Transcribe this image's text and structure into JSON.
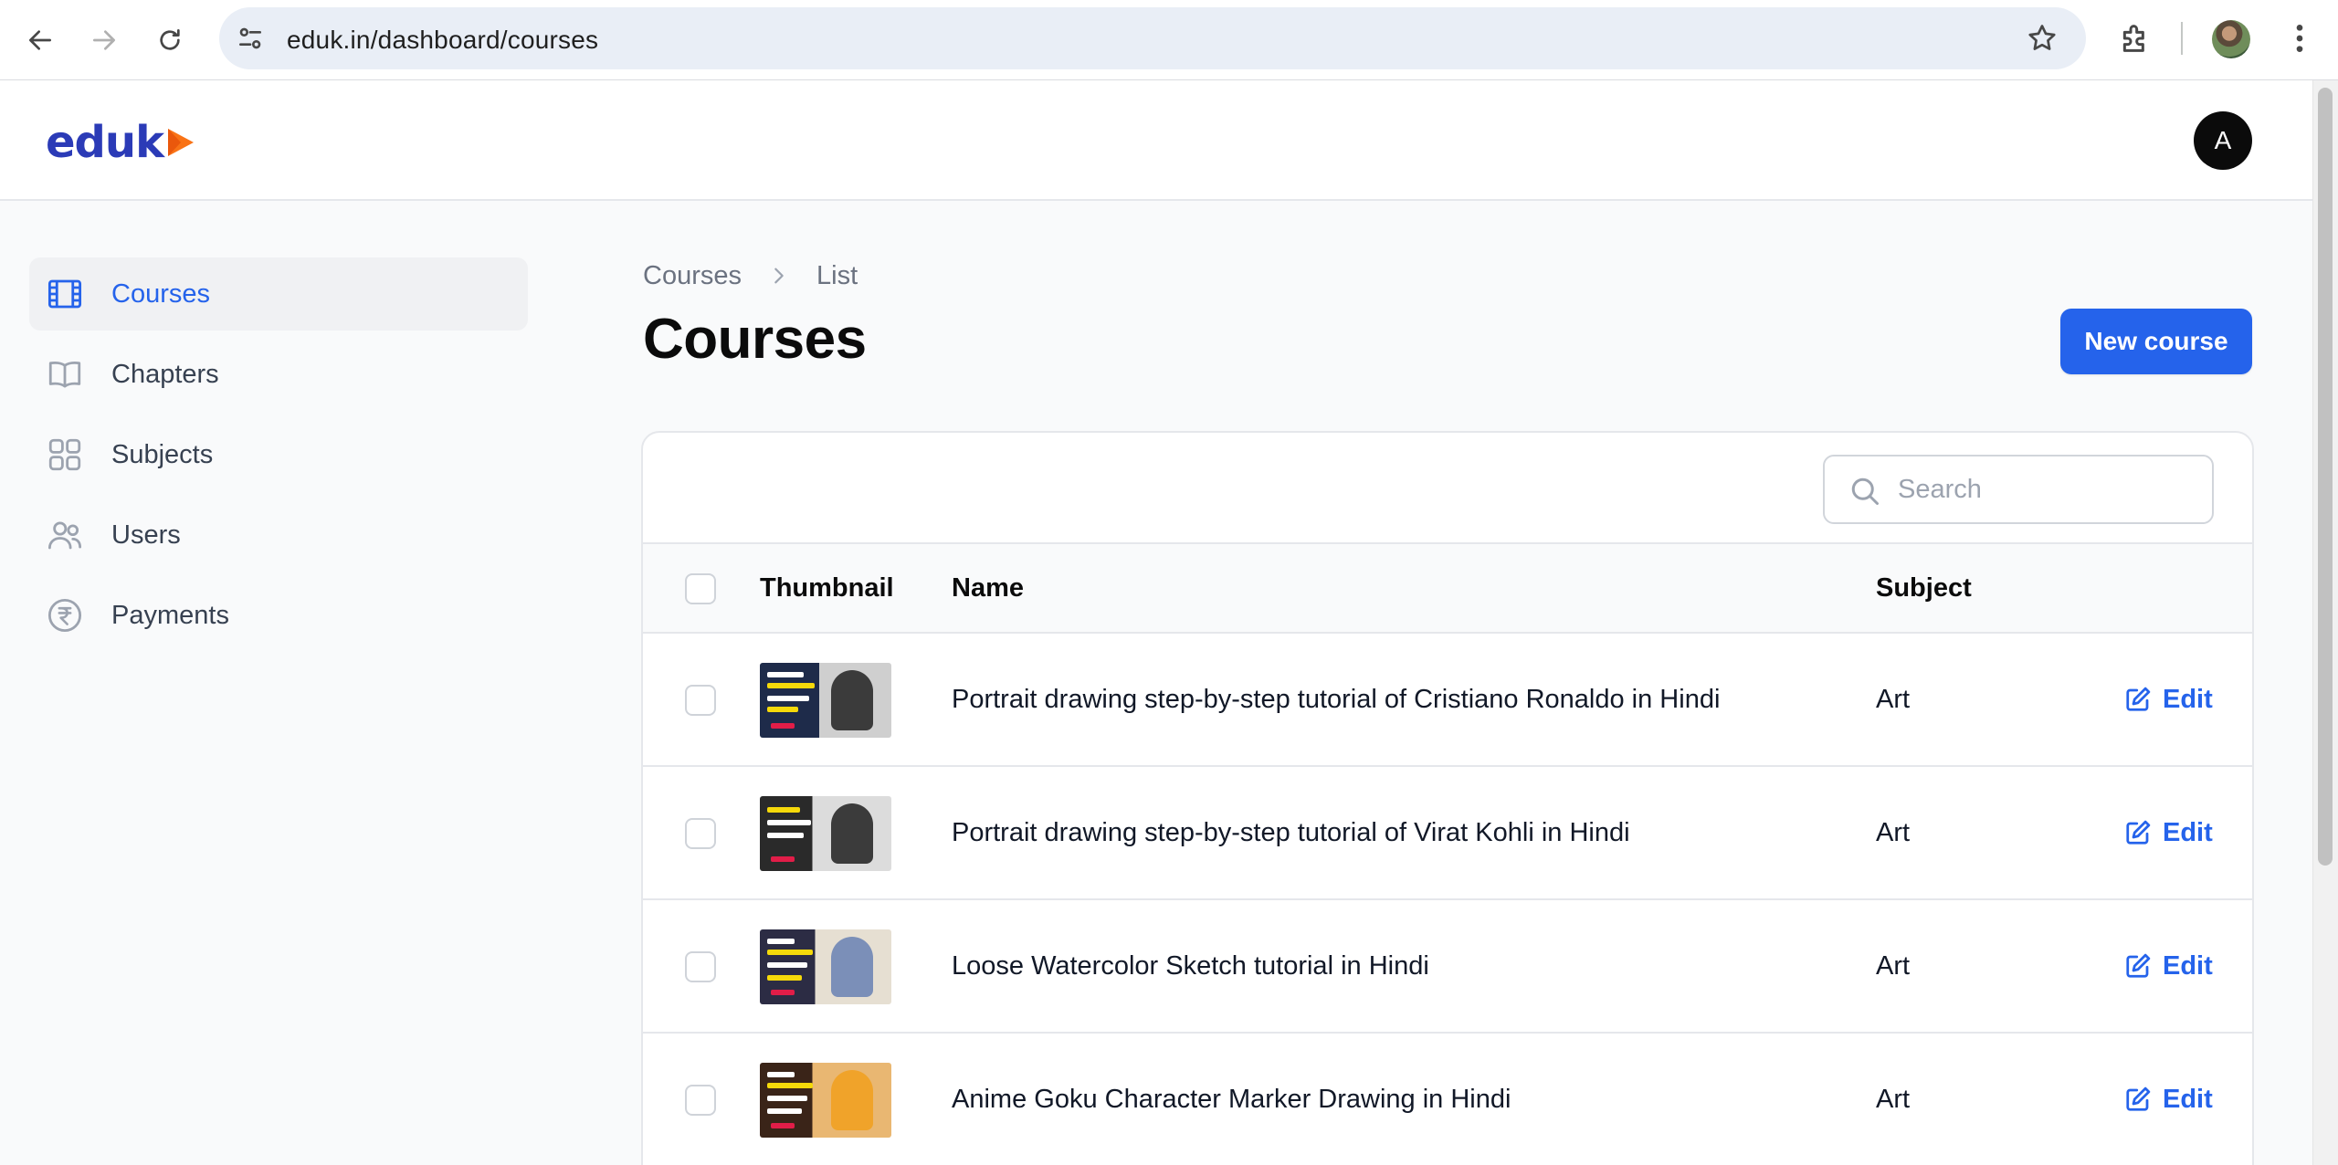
{
  "browser": {
    "url": "eduk.in/dashboard/courses"
  },
  "app": {
    "logo_text": "eduk",
    "avatar_initial": "A"
  },
  "sidebar": {
    "items": [
      {
        "label": "Courses",
        "icon": "film-icon",
        "active": true
      },
      {
        "label": "Chapters",
        "icon": "book-icon",
        "active": false
      },
      {
        "label": "Subjects",
        "icon": "grid-icon",
        "active": false
      },
      {
        "label": "Users",
        "icon": "users-icon",
        "active": false
      },
      {
        "label": "Payments",
        "icon": "rupee-icon",
        "active": false
      }
    ]
  },
  "breadcrumb": [
    "Courses",
    "List"
  ],
  "page": {
    "title": "Courses",
    "new_button": "New course"
  },
  "table": {
    "search_placeholder": "Search",
    "columns": {
      "thumbnail": "Thumbnail",
      "name": "Name",
      "subject": "Subject"
    },
    "edit_label": "Edit",
    "rows": [
      {
        "name": "Portrait drawing step-by-step tutorial of Cristiano Ronaldo in Hindi",
        "subject": "Art"
      },
      {
        "name": "Portrait drawing step-by-step tutorial of Virat Kohli in Hindi",
        "subject": "Art"
      },
      {
        "name": "Loose Watercolor Sketch tutorial in Hindi",
        "subject": "Art"
      },
      {
        "name": "Anime Goku Character Marker Drawing in Hindi",
        "subject": "Art"
      }
    ]
  },
  "colors": {
    "accent": "#2563eb",
    "logo": "#2b3bb7",
    "logo_play": "#f97316"
  }
}
